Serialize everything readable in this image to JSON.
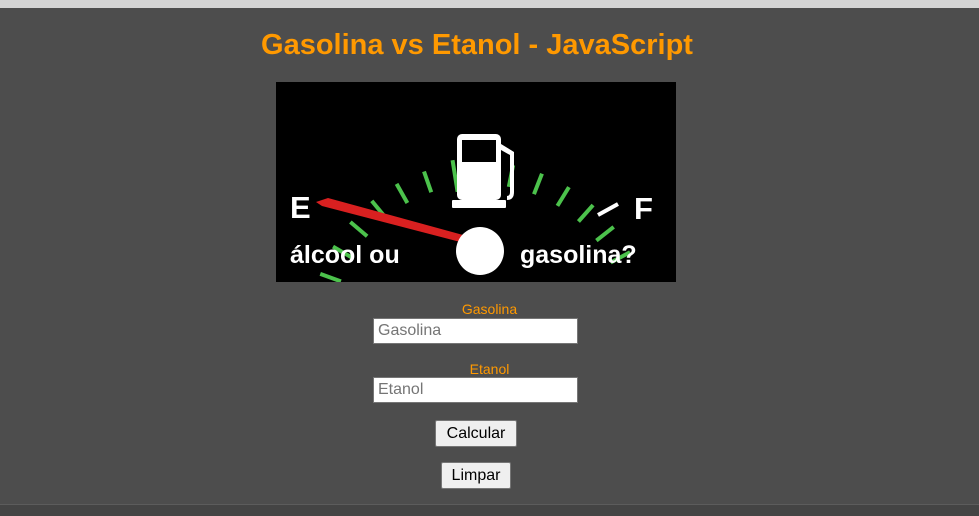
{
  "page": {
    "title": "Gasolina vs Etanol - JavaScript"
  },
  "gauge_image": {
    "empty_mark": "E",
    "full_mark": "F",
    "caption_left": "álcool ou",
    "caption_right": "gasolina?",
    "icon": "fuel-pump-icon",
    "colors": {
      "background": "#000000",
      "ticks": "#4cc24c",
      "needle": "#d92020",
      "text": "#ffffff"
    }
  },
  "form": {
    "gasolina": {
      "label": "Gasolina",
      "placeholder": "Gasolina",
      "value": ""
    },
    "etanol": {
      "label": "Etanol",
      "placeholder": "Etanol",
      "value": ""
    },
    "calcular_label": "Calcular",
    "limpar_label": "Limpar"
  },
  "colors": {
    "background": "#4d4d4d",
    "accent": "#ff9900"
  }
}
